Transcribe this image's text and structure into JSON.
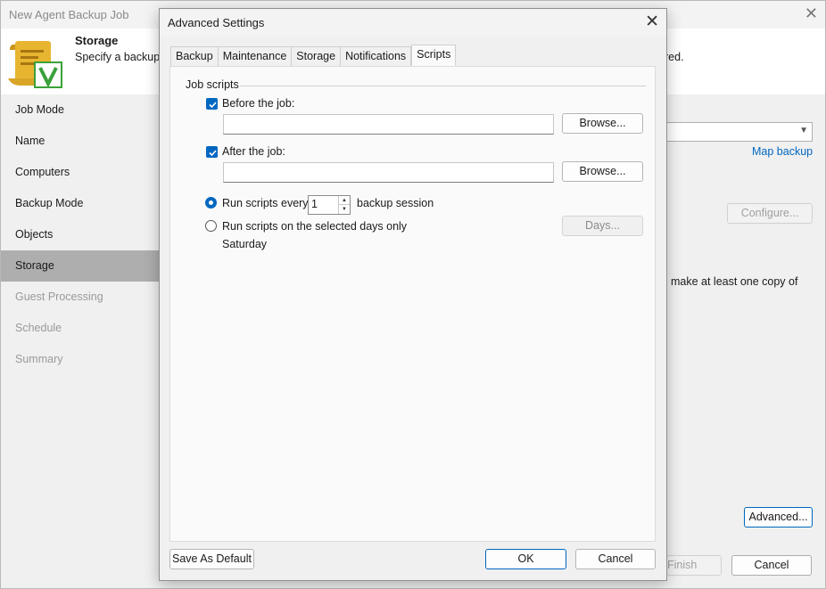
{
  "wizard": {
    "title": "New Agent Backup Job",
    "header_title": "Storage",
    "header_desc": "Specify a backup r",
    "header_desc_tail": "red.",
    "nav": [
      {
        "label": "Job Mode",
        "state": "normal"
      },
      {
        "label": "Name",
        "state": "normal"
      },
      {
        "label": "Computers",
        "state": "normal"
      },
      {
        "label": "Backup Mode",
        "state": "normal"
      },
      {
        "label": "Objects",
        "state": "normal"
      },
      {
        "label": "Storage",
        "state": "active"
      },
      {
        "label": "Guest Processing",
        "state": "disabled"
      },
      {
        "label": "Schedule",
        "state": "disabled"
      },
      {
        "label": "Summary",
        "state": "disabled"
      }
    ],
    "map_backup_link": "Map backup",
    "configure_button": "Configure...",
    "copy_text": "make at least one copy of",
    "advanced_button": "Advanced...",
    "finish_button": "Finish",
    "cancel_button": "Cancel"
  },
  "dialog": {
    "title": "Advanced Settings",
    "tabs": [
      "Backup",
      "Maintenance",
      "Storage",
      "Notifications",
      "Scripts"
    ],
    "active_tab": "Scripts",
    "group_label": "Job scripts",
    "before_job": {
      "label": "Before the job:",
      "checked": true,
      "value": "",
      "browse": "Browse..."
    },
    "after_job": {
      "label": "After the job:",
      "checked": true,
      "value": "",
      "browse": "Browse..."
    },
    "run_every": {
      "label": "Run scripts every",
      "value": "1",
      "suffix": "backup session",
      "selected": true
    },
    "run_days": {
      "label": "Run scripts on the selected days only",
      "days_value": "Saturday",
      "button": "Days...",
      "selected": false
    },
    "save_default": "Save As Default",
    "ok": "OK",
    "cancel": "Cancel"
  },
  "colors": {
    "accent": "#0067c0",
    "nav_active": "#aeaeae",
    "logo_yellow": "#e8b531",
    "logo_green": "#3aa13a"
  }
}
